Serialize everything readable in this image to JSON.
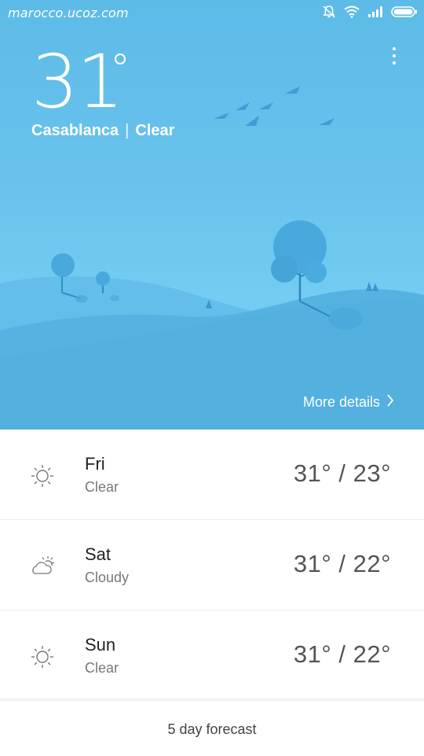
{
  "watermark": "marocco.ucoz.com",
  "status": {
    "icons": [
      "bell-off-icon",
      "wifi-icon",
      "signal-icon",
      "battery-icon"
    ]
  },
  "current": {
    "temperature": "31",
    "city": "Casablanca",
    "separator": "|",
    "condition": "Clear"
  },
  "more_details_label": "More details",
  "forecast": [
    {
      "day": "Fri",
      "condition": "Clear",
      "range": "31° / 23°",
      "icon": "sun-icon"
    },
    {
      "day": "Sat",
      "condition": "Cloudy",
      "range": "31° / 22°",
      "icon": "cloud-sun-icon"
    },
    {
      "day": "Sun",
      "condition": "Clear",
      "range": "31° / 22°",
      "icon": "sun-icon"
    }
  ],
  "five_day_label": "5 day forecast",
  "colors": {
    "sky": "#69c3ec",
    "hills": "#58b5e2",
    "text_primary": "#222222",
    "text_secondary": "#777777"
  }
}
